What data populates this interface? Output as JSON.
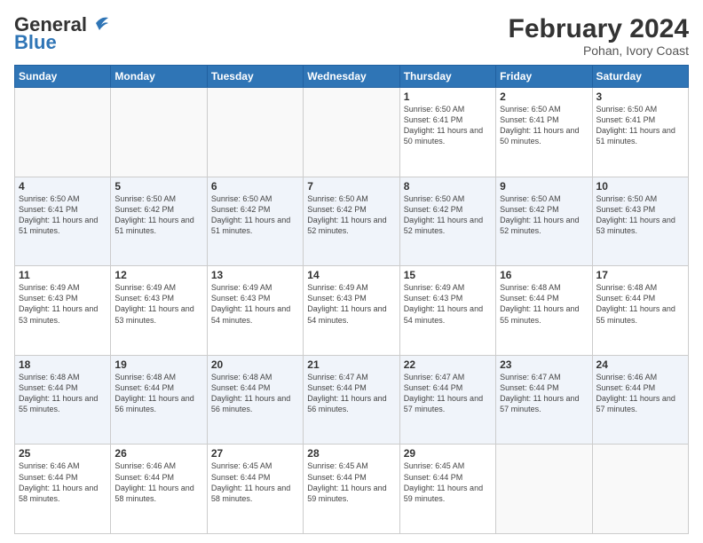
{
  "header": {
    "logo_line1": "General",
    "logo_line2": "Blue",
    "month_title": "February 2024",
    "subtitle": "Pohan, Ivory Coast"
  },
  "days_of_week": [
    "Sunday",
    "Monday",
    "Tuesday",
    "Wednesday",
    "Thursday",
    "Friday",
    "Saturday"
  ],
  "weeks": [
    [
      {
        "day": "",
        "info": ""
      },
      {
        "day": "",
        "info": ""
      },
      {
        "day": "",
        "info": ""
      },
      {
        "day": "",
        "info": ""
      },
      {
        "day": "1",
        "info": "Sunrise: 6:50 AM\nSunset: 6:41 PM\nDaylight: 11 hours\nand 50 minutes."
      },
      {
        "day": "2",
        "info": "Sunrise: 6:50 AM\nSunset: 6:41 PM\nDaylight: 11 hours\nand 50 minutes."
      },
      {
        "day": "3",
        "info": "Sunrise: 6:50 AM\nSunset: 6:41 PM\nDaylight: 11 hours\nand 51 minutes."
      }
    ],
    [
      {
        "day": "4",
        "info": "Sunrise: 6:50 AM\nSunset: 6:41 PM\nDaylight: 11 hours\nand 51 minutes."
      },
      {
        "day": "5",
        "info": "Sunrise: 6:50 AM\nSunset: 6:42 PM\nDaylight: 11 hours\nand 51 minutes."
      },
      {
        "day": "6",
        "info": "Sunrise: 6:50 AM\nSunset: 6:42 PM\nDaylight: 11 hours\nand 51 minutes."
      },
      {
        "day": "7",
        "info": "Sunrise: 6:50 AM\nSunset: 6:42 PM\nDaylight: 11 hours\nand 52 minutes."
      },
      {
        "day": "8",
        "info": "Sunrise: 6:50 AM\nSunset: 6:42 PM\nDaylight: 11 hours\nand 52 minutes."
      },
      {
        "day": "9",
        "info": "Sunrise: 6:50 AM\nSunset: 6:42 PM\nDaylight: 11 hours\nand 52 minutes."
      },
      {
        "day": "10",
        "info": "Sunrise: 6:50 AM\nSunset: 6:43 PM\nDaylight: 11 hours\nand 53 minutes."
      }
    ],
    [
      {
        "day": "11",
        "info": "Sunrise: 6:49 AM\nSunset: 6:43 PM\nDaylight: 11 hours\nand 53 minutes."
      },
      {
        "day": "12",
        "info": "Sunrise: 6:49 AM\nSunset: 6:43 PM\nDaylight: 11 hours\nand 53 minutes."
      },
      {
        "day": "13",
        "info": "Sunrise: 6:49 AM\nSunset: 6:43 PM\nDaylight: 11 hours\nand 54 minutes."
      },
      {
        "day": "14",
        "info": "Sunrise: 6:49 AM\nSunset: 6:43 PM\nDaylight: 11 hours\nand 54 minutes."
      },
      {
        "day": "15",
        "info": "Sunrise: 6:49 AM\nSunset: 6:43 PM\nDaylight: 11 hours\nand 54 minutes."
      },
      {
        "day": "16",
        "info": "Sunrise: 6:48 AM\nSunset: 6:44 PM\nDaylight: 11 hours\nand 55 minutes."
      },
      {
        "day": "17",
        "info": "Sunrise: 6:48 AM\nSunset: 6:44 PM\nDaylight: 11 hours\nand 55 minutes."
      }
    ],
    [
      {
        "day": "18",
        "info": "Sunrise: 6:48 AM\nSunset: 6:44 PM\nDaylight: 11 hours\nand 55 minutes."
      },
      {
        "day": "19",
        "info": "Sunrise: 6:48 AM\nSunset: 6:44 PM\nDaylight: 11 hours\nand 56 minutes."
      },
      {
        "day": "20",
        "info": "Sunrise: 6:48 AM\nSunset: 6:44 PM\nDaylight: 11 hours\nand 56 minutes."
      },
      {
        "day": "21",
        "info": "Sunrise: 6:47 AM\nSunset: 6:44 PM\nDaylight: 11 hours\nand 56 minutes."
      },
      {
        "day": "22",
        "info": "Sunrise: 6:47 AM\nSunset: 6:44 PM\nDaylight: 11 hours\nand 57 minutes."
      },
      {
        "day": "23",
        "info": "Sunrise: 6:47 AM\nSunset: 6:44 PM\nDaylight: 11 hours\nand 57 minutes."
      },
      {
        "day": "24",
        "info": "Sunrise: 6:46 AM\nSunset: 6:44 PM\nDaylight: 11 hours\nand 57 minutes."
      }
    ],
    [
      {
        "day": "25",
        "info": "Sunrise: 6:46 AM\nSunset: 6:44 PM\nDaylight: 11 hours\nand 58 minutes."
      },
      {
        "day": "26",
        "info": "Sunrise: 6:46 AM\nSunset: 6:44 PM\nDaylight: 11 hours\nand 58 minutes."
      },
      {
        "day": "27",
        "info": "Sunrise: 6:45 AM\nSunset: 6:44 PM\nDaylight: 11 hours\nand 58 minutes."
      },
      {
        "day": "28",
        "info": "Sunrise: 6:45 AM\nSunset: 6:44 PM\nDaylight: 11 hours\nand 59 minutes."
      },
      {
        "day": "29",
        "info": "Sunrise: 6:45 AM\nSunset: 6:44 PM\nDaylight: 11 hours\nand 59 minutes."
      },
      {
        "day": "",
        "info": ""
      },
      {
        "day": "",
        "info": ""
      }
    ]
  ]
}
